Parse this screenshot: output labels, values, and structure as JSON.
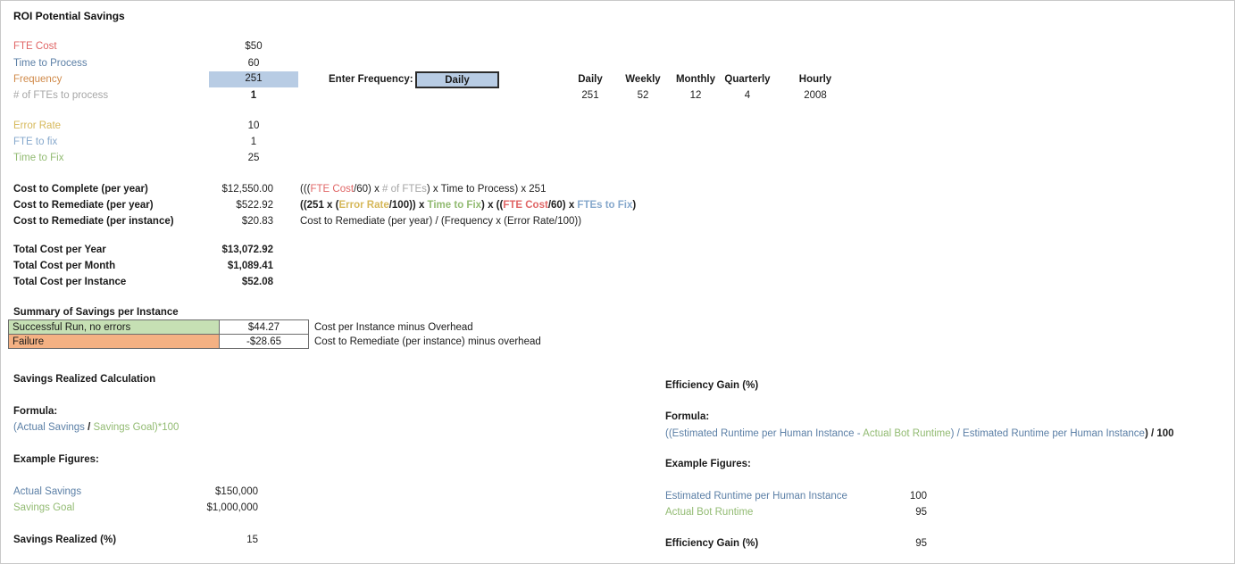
{
  "page": {
    "title": "ROI Potential Savings"
  },
  "inputs": {
    "rows": [
      {
        "label": "FTE Cost",
        "value": "$50",
        "color": "c-red"
      },
      {
        "label": "Time to Process",
        "value": "60",
        "color": "c-blue"
      },
      {
        "label": "Frequency",
        "value": "251",
        "color": "c-orange"
      },
      {
        "label": "# of FTEs to process",
        "value": "1",
        "color": "c-gray"
      }
    ],
    "error_rows": [
      {
        "label": "Error Rate",
        "value": "10",
        "color": "c-amber"
      },
      {
        "label": "FTE to fix",
        "value": "1",
        "color": "c-ltblue"
      },
      {
        "label": "Time to Fix",
        "value": "25",
        "color": "c-green"
      }
    ]
  },
  "frequency_selector": {
    "prompt": "Enter Frequency:",
    "selected": "Daily",
    "options": [
      "Daily",
      "Weekly",
      "Monthly",
      "Quarterly",
      "Hourly"
    ]
  },
  "frequency_table": {
    "headers": [
      "Daily",
      "Weekly",
      "Monthly",
      "Quarterly",
      "Hourly"
    ],
    "values": [
      "251",
      "52",
      "12",
      "4",
      "2008"
    ]
  },
  "costs": {
    "rows": [
      {
        "label": "Cost to Complete (per year)",
        "value": "$12,550.00"
      },
      {
        "label": "Cost to Remediate (per year)",
        "value": "$522.92"
      },
      {
        "label": "Cost to Remediate (per instance)",
        "value": "$20.83"
      }
    ],
    "formulas": {
      "complete": {
        "p1": "(((",
        "t1": "FTE Cost",
        "p2": "/60) x ",
        "t2": "# of FTEs",
        "p3": ") x ",
        "t3": "Time to Process",
        "p4": ") x 251"
      },
      "remediate_year": {
        "p1": "((251 x (",
        "t1": "Error Rate",
        "p2": "/100)) x ",
        "t2": "Time to Fix",
        "p3": ") x ((",
        "t3": "FTE Cost",
        "p4": "/60) x ",
        "t4": "FTEs to Fix",
        "p5": ")"
      },
      "remediate_instance": "Cost to Remediate (per year) / (Frequency x (Error Rate/100))"
    }
  },
  "totals": {
    "rows": [
      {
        "label": "Total Cost per Year",
        "value": "$13,072.92"
      },
      {
        "label": "Total Cost per Month",
        "value": "$1,089.41"
      },
      {
        "label": "Total Cost per Instance",
        "value": "$52.08"
      }
    ]
  },
  "summary": {
    "title": "Summary of Savings per Instance",
    "rows": [
      {
        "label": "Successful Run, no errors",
        "value": "$44.27",
        "note": "Cost per Instance minus Overhead",
        "fill": "#c6e0b4"
      },
      {
        "label": "Failure",
        "value": "-$28.65",
        "note": "Cost to Remediate (per instance) minus overhead",
        "fill": "#f4b183"
      }
    ]
  },
  "savings_realized": {
    "title": "Savings Realized Calculation",
    "formula_heading": "Formula:",
    "formula": {
      "p1": "(",
      "t1": "Actual Savings",
      "p2": " / ",
      "t2": "Savings Goal",
      "p3": ")*100"
    },
    "examples_heading": "Example Figures:",
    "examples": [
      {
        "label": "Actual Savings",
        "value": "$150,000",
        "color": "c-blue"
      },
      {
        "label": "Savings Goal",
        "value": "$1,000,000",
        "color": "c-green"
      }
    ],
    "result": {
      "label": "Savings Realized (%)",
      "value": "15"
    }
  },
  "efficiency_gain": {
    "title": "Efficiency Gain (%)",
    "formula_heading": "Formula:",
    "formula": {
      "p1": "((",
      "t1": "Estimated Runtime per Human Instance",
      "p2": " - ",
      "t2": "Actual Bot Runtime",
      "p3": ") / ",
      "t3": "Estimated Runtime per Human Instance",
      "p4": ") / 100"
    },
    "examples_heading": "Example Figures:",
    "examples": [
      {
        "label": "Estimated Runtime per Human Instance",
        "value": "100",
        "color": "c-blue"
      },
      {
        "label": "Actual Bot Runtime",
        "value": "95",
        "color": "c-green"
      }
    ],
    "result": {
      "label": "Efficiency Gain (%)",
      "value": "95"
    }
  },
  "colors": {
    "fte_cost": "#e06666",
    "time_to_process": "#5b7fa6",
    "frequency": "#d08a4a",
    "num_ftes": "#a6a6a6",
    "error_rate": "#d6b85a",
    "fte_to_fix": "#86a8cc",
    "time_to_fix": "#92bb72",
    "highlight_cell": "#b8cce4",
    "success_fill": "#c6e0b4",
    "failure_fill": "#f4b183"
  }
}
